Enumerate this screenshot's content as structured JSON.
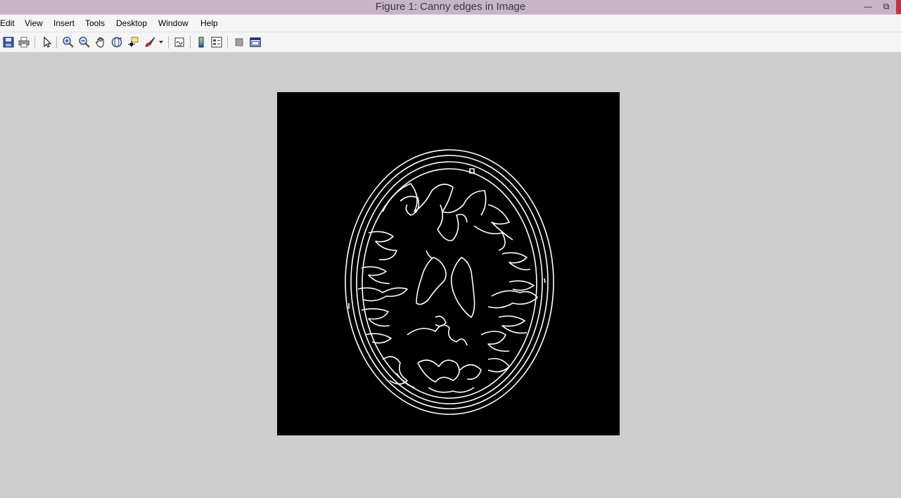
{
  "window": {
    "title": "Figure 1: Canny edges in Image",
    "minimize_glyph": "—",
    "restore_glyph": "⧉"
  },
  "menu": {
    "items": [
      {
        "label": "Edit"
      },
      {
        "label": "View"
      },
      {
        "label": "Insert"
      },
      {
        "label": "Tools"
      },
      {
        "label": "Desktop"
      },
      {
        "label": "Window"
      },
      {
        "label": "Help"
      }
    ]
  },
  "toolbar": {
    "buttons": [
      {
        "icon": "save-icon"
      },
      {
        "icon": "print-icon"
      },
      {
        "icon": "edit-plot-arrow-icon"
      },
      {
        "icon": "zoom-in-icon"
      },
      {
        "icon": "zoom-out-icon"
      },
      {
        "icon": "pan-hand-icon"
      },
      {
        "icon": "rotate-3d-icon"
      },
      {
        "icon": "data-cursor-icon"
      },
      {
        "icon": "brush-icon"
      },
      {
        "icon": "link-plot-icon"
      },
      {
        "icon": "colorbar-icon"
      },
      {
        "icon": "legend-icon"
      },
      {
        "icon": "hide-plot-tools-icon"
      },
      {
        "icon": "show-plot-tools-icon"
      }
    ]
  },
  "colors": {
    "titlebar": "#c9b3c9",
    "figure_background": "#cdcdcd",
    "image_background": "#000000",
    "edge_color": "#ffffff",
    "close_accent": "#c8323c"
  }
}
